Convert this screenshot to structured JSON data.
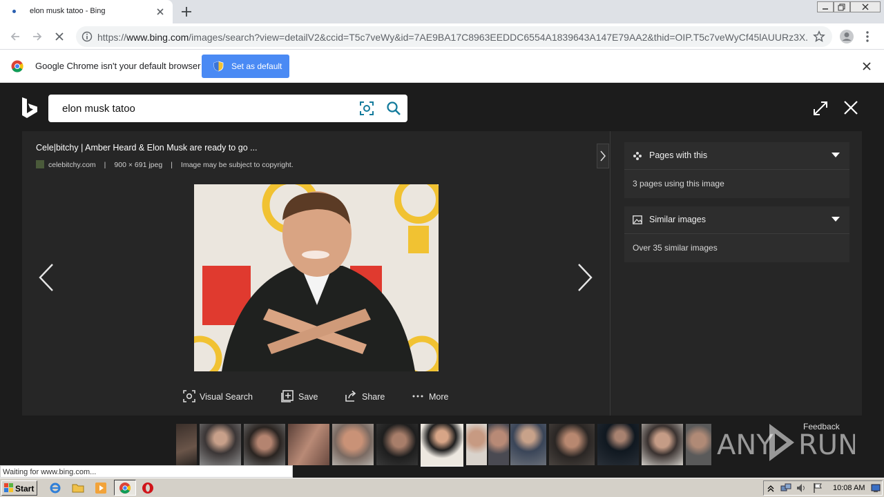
{
  "browser": {
    "tab_title": "elon musk tatoo - Bing",
    "url_prefix": "https://",
    "url_domain": "www.bing.com",
    "url_rest": "/images/search?view=detailV2&ccid=T5c7veWy&id=7AE9BA17C8963EEDDC6554A1839643A147E79AA2&thid=OIP.T5c7veWyCf45lAUURz3X..."
  },
  "infobar": {
    "message": "Google Chrome isn't your default browser",
    "button": "Set as default"
  },
  "bing": {
    "query": "elon musk tatoo",
    "image_title": "Cele|bitchy | Amber Heard & Elon Musk are ready to go ...",
    "source": "celebitchy.com",
    "dimensions": "900 × 691 jpeg",
    "copyright": "Image may be subject to copyright.",
    "actions": {
      "visual_search": "Visual Search",
      "save": "Save",
      "share": "Share",
      "more": "More"
    },
    "pages_card": {
      "title": "Pages with this",
      "body": "3 pages using this image"
    },
    "similar_card": {
      "title": "Similar images",
      "body": "Over 35 similar images"
    },
    "feedback": "Feedback",
    "watermark": "ANY RUN"
  },
  "status": "Waiting for www.bing.com...",
  "taskbar": {
    "start": "Start",
    "clock": "10:08 AM"
  },
  "colors": {
    "accent_blue": "#4a8af4",
    "bing_bg": "#1c1c1c",
    "panel_bg": "#262626"
  }
}
